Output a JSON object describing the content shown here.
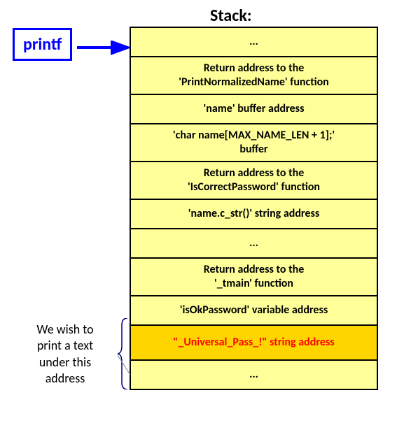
{
  "title": "Stack:",
  "printf": "printf",
  "rows": {
    "r0": "...",
    "r1a": "Return address to the",
    "r1b": "'PrintNormalizedName' function",
    "r2": "'name' buffer address",
    "r3a": "'char name[MAX_NAME_LEN + 1];'",
    "r3b": "buffer",
    "r4a": "Return address to the",
    "r4b": "'IsCorrectPassword' function",
    "r5": "'name.c_str()' string address",
    "r6": "...",
    "r7a": "Return address to the",
    "r7b": "'_tmain' function",
    "r8": "'isOkPassword' variable address",
    "r9": "\"_Universal_Pass_!\" string address",
    "r10": "..."
  },
  "annotation": {
    "l1": "We wish to",
    "l2": "print a text",
    "l3": "under this",
    "l4": "address"
  }
}
